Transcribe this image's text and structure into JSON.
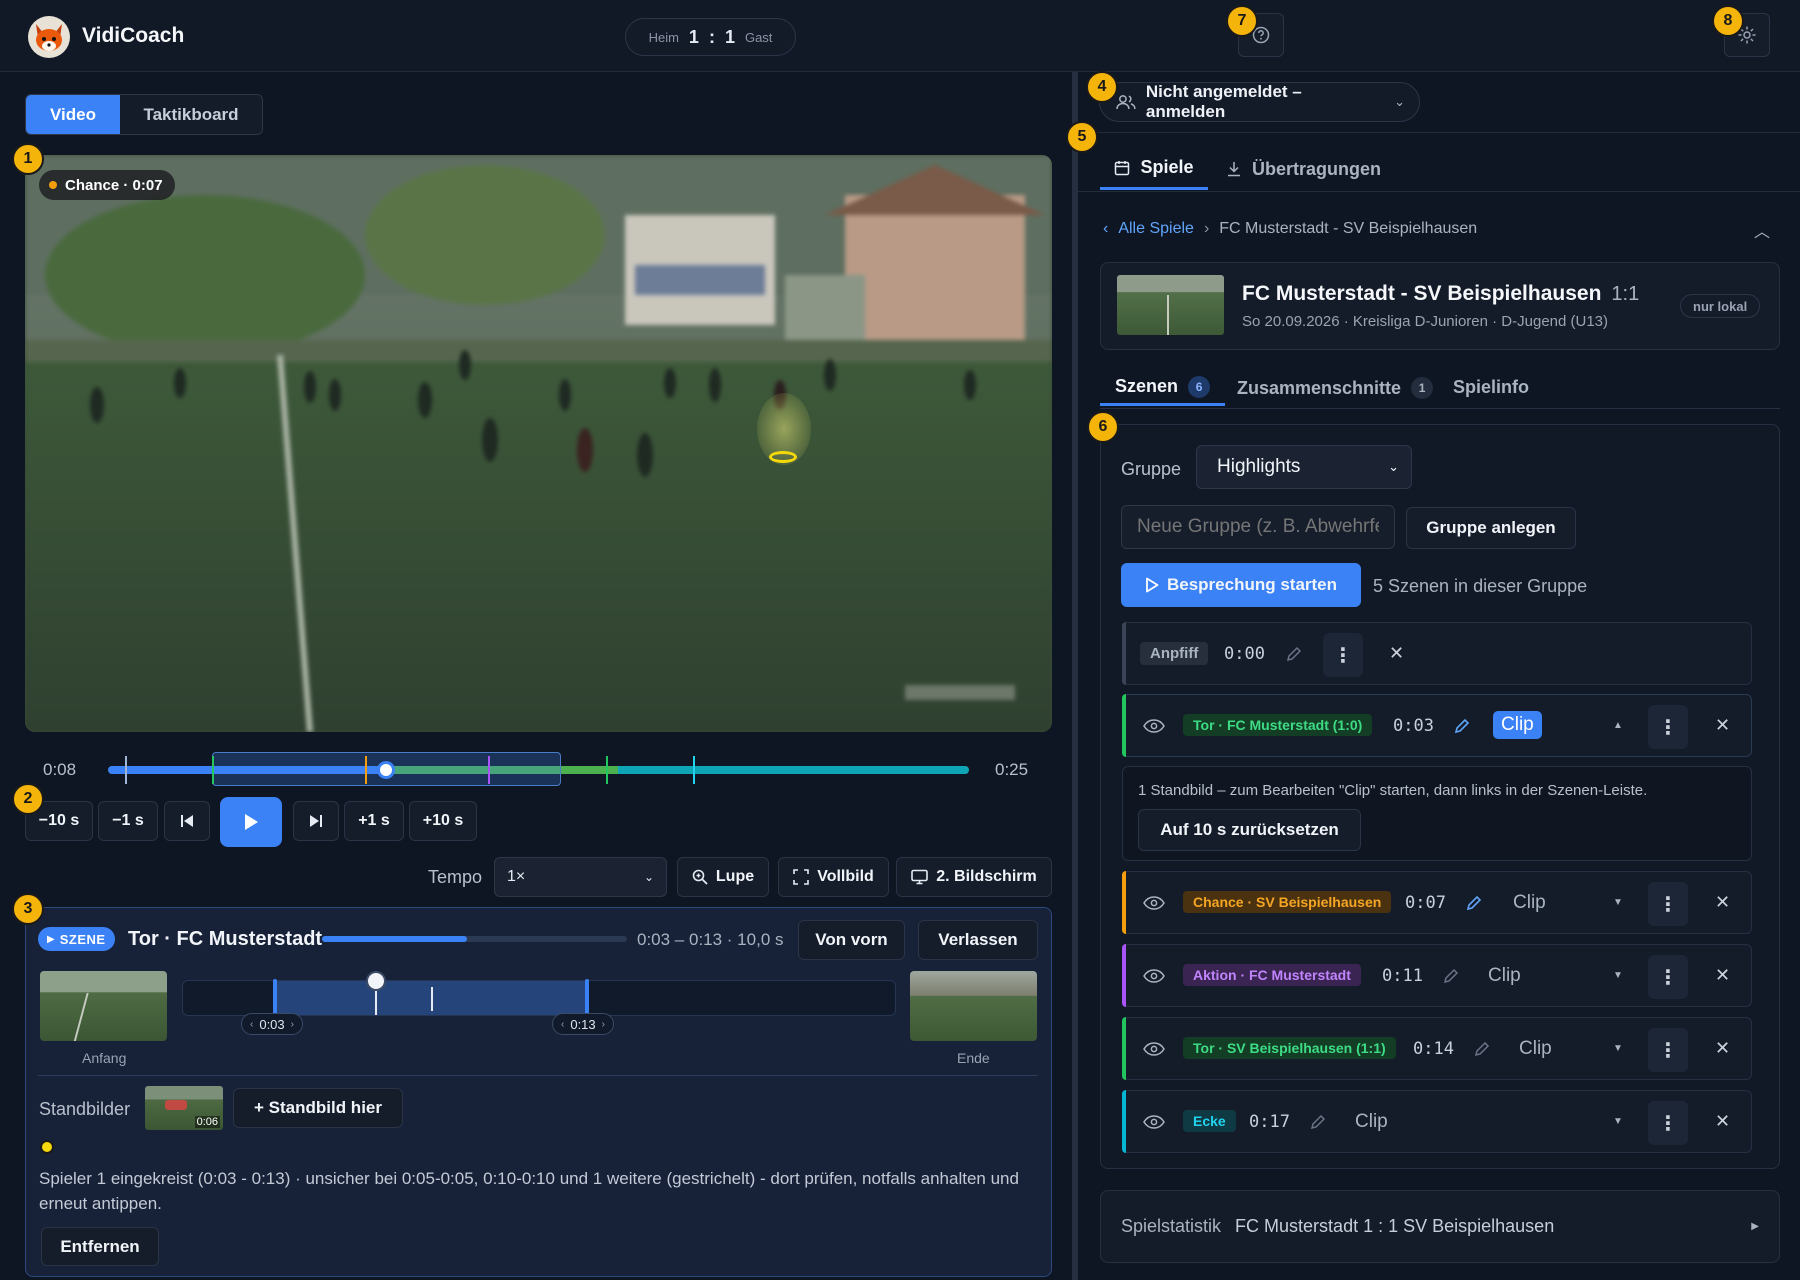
{
  "app": {
    "name": "VidiCoach"
  },
  "score": {
    "home_label": "Heim",
    "home": "1",
    "sep": ":",
    "away": "1",
    "away_label": "Gast"
  },
  "badges": [
    "1",
    "2",
    "3",
    "4",
    "5",
    "6",
    "7",
    "8"
  ],
  "left": {
    "tabs": [
      {
        "label": "Video",
        "active": true
      },
      {
        "label": "Taktikboard",
        "active": false
      }
    ],
    "video_badge": "Chance · 0:07",
    "timeline": {
      "start": "0:08",
      "end": "0:25",
      "progress": 0.32
    },
    "controls": [
      "−10 s",
      "−1 s",
      "+1 s",
      "+10 s"
    ],
    "tempo_label": "Tempo",
    "tempo_value": "1×",
    "tools": {
      "lupe": "Lupe",
      "vollbild": "Vollbild",
      "screen2": "2. Bildschirm"
    },
    "scene": {
      "badge": "SZENE",
      "title": "Tor · FC Musterstadt",
      "range": "0:03 – 0:13 · 10,0 s",
      "restart": "Von vorn",
      "leave": "Verlassen",
      "start_label": "Anfang",
      "end_label": "Ende",
      "marker_start": "0:03",
      "marker_end": "0:13",
      "stills_label": "Standbilder",
      "still_time": "0:06",
      "add_still": "+ Standbild hier",
      "note": "Spieler 1 eingekreist (0:03 - 0:13) · unsicher bei 0:05-0:05, 0:10-0:10 und 1 weitere (gestrichelt) - dort prüfen, notfalls anhalten und erneut antippen.",
      "remove": "Entfernen"
    }
  },
  "right": {
    "login": "Nicht angemeldet – anmelden",
    "tabs": {
      "games": "Spiele",
      "transfers": "Übertragungen"
    },
    "breadcrumb": {
      "back": "Alle Spiele",
      "sep": "›",
      "current": "FC Musterstadt - SV Beispielhausen"
    },
    "match": {
      "title": "FC Musterstadt - SV Beispielhausen",
      "score": "1:1",
      "meta": "So 20.09.2026 · Kreisliga D-Junioren · D-Jugend (U13)",
      "local": "nur lokal"
    },
    "subtabs": {
      "scenes": "Szenen",
      "scenes_count": "6",
      "cuts": "Zusammenschnitte",
      "cuts_count": "1",
      "info": "Spielinfo"
    },
    "group_label": "Gruppe",
    "group_value": "Highlights",
    "new_group_placeholder": "Neue Gruppe (z. B. Abwehrfehler)",
    "create_group": "Gruppe anlegen",
    "start_review": "Besprechung starten",
    "scenes_in_group": "5 Szenen in dieser Gruppe",
    "kickoff": {
      "label": "Anpfiff",
      "time": "0:00"
    },
    "scenes": [
      {
        "tag": "Tor · FC Musterstadt (1:0)",
        "time": "0:03",
        "clip": "Clip",
        "color": "#22c55e",
        "tag_bg": "#143d26",
        "tag_fg": "#3ddc84",
        "active": true
      },
      {
        "tag": "Chance · SV Beispielhausen",
        "time": "0:07",
        "clip": "Clip",
        "color": "#f59e0b",
        "tag_bg": "#4a3210",
        "tag_fg": "#f5a524",
        "active": false
      },
      {
        "tag": "Aktion · FC Musterstadt",
        "time": "0:11",
        "clip": "Clip",
        "color": "#a855f7",
        "tag_bg": "#3a2452",
        "tag_fg": "#c084fc",
        "active": false
      },
      {
        "tag": "Tor · SV Beispielhausen (1:1)",
        "time": "0:14",
        "clip": "Clip",
        "color": "#22c55e",
        "tag_bg": "#143d26",
        "tag_fg": "#3ddc84",
        "active": false
      },
      {
        "tag": "Ecke",
        "time": "0:17",
        "clip": "Clip",
        "color": "#06b6d4",
        "tag_bg": "#0f3a44",
        "tag_fg": "#22d3ee",
        "active": false
      }
    ],
    "still_note": "1 Standbild – zum Bearbeiten \"Clip\" starten, dann links in der Szenen-Leiste.",
    "reset": "Auf 10 s zurücksetzen",
    "stats_label": "Spielstatistik",
    "stats_value": "FC Musterstadt 1 : 1 SV Beispielhausen"
  }
}
